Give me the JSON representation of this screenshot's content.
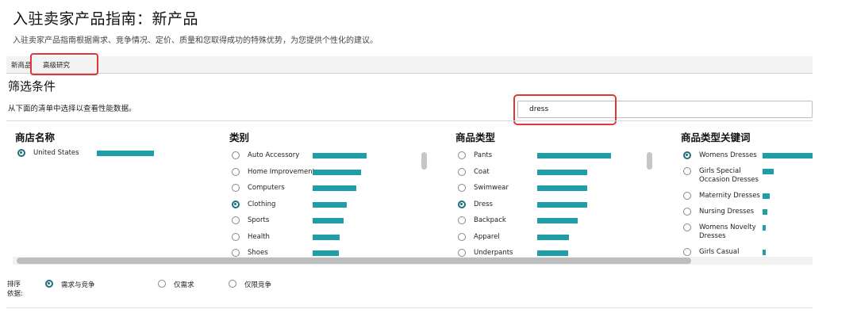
{
  "header": {
    "title": "入驻卖家产品指南：新产品",
    "subtitle": "入驻卖家产品指南根据需求、竞争情况、定价、质量和您取得成功的特殊优势，为您提供个性化的建议。"
  },
  "tabs": [
    {
      "label": "新商品"
    },
    {
      "label": "高级研究"
    }
  ],
  "filters": {
    "title": "筛选条件",
    "description": "从下面的清单中选择以查看性能数据。",
    "search_value": "dress"
  },
  "columns": {
    "store": {
      "header": "商店名称",
      "items": [
        {
          "label": "United States",
          "selected": true,
          "value": 0.72
        }
      ]
    },
    "category": {
      "header": "类别",
      "items": [
        {
          "label": "Auto Accessory",
          "selected": false,
          "value": 0.72
        },
        {
          "label": "Home Improvement",
          "selected": false,
          "value": 0.65
        },
        {
          "label": "Computers",
          "selected": false,
          "value": 0.59
        },
        {
          "label": "Clothing",
          "selected": true,
          "value": 0.46
        },
        {
          "label": "Sports",
          "selected": false,
          "value": 0.41
        },
        {
          "label": "Health",
          "selected": false,
          "value": 0.36
        },
        {
          "label": "Shoes",
          "selected": false,
          "value": 0.35
        }
      ]
    },
    "product_type": {
      "header": "商品类型",
      "items": [
        {
          "label": "Pants",
          "selected": false,
          "value": 0.97
        },
        {
          "label": "Coat",
          "selected": false,
          "value": 0.66
        },
        {
          "label": "Swimwear",
          "selected": false,
          "value": 0.66
        },
        {
          "label": "Dress",
          "selected": true,
          "value": 0.66
        },
        {
          "label": "Backpack",
          "selected": false,
          "value": 0.53
        },
        {
          "label": "Apparel",
          "selected": false,
          "value": 0.42
        },
        {
          "label": "Underpants",
          "selected": false,
          "value": 0.41
        }
      ]
    },
    "keywords": {
      "header": "商品类型关键词",
      "items": [
        {
          "label": "Womens Dresses",
          "selected": true,
          "value": 1.0
        },
        {
          "label": "Girls Special Occasion Dresses",
          "selected": false,
          "value": 0.22
        },
        {
          "label": "Maternity Dresses",
          "selected": false,
          "value": 0.14
        },
        {
          "label": "Nursing Dresses",
          "selected": false,
          "value": 0.09
        },
        {
          "label": "Womens Novelty Dresses",
          "selected": false,
          "value": 0.07
        },
        {
          "label": "Girls Casual Dresses",
          "selected": false,
          "value": 0.06
        }
      ]
    }
  },
  "sort": {
    "label": "排序依据:",
    "options": [
      {
        "label": "需求与竞争",
        "selected": true
      },
      {
        "label": "仅需求",
        "selected": false
      },
      {
        "label": "仅限竞争",
        "selected": false
      }
    ]
  },
  "colors": {
    "bar": "#1f9ea8",
    "selected_radio": "#1f6f78",
    "highlight": "#e0353b"
  }
}
